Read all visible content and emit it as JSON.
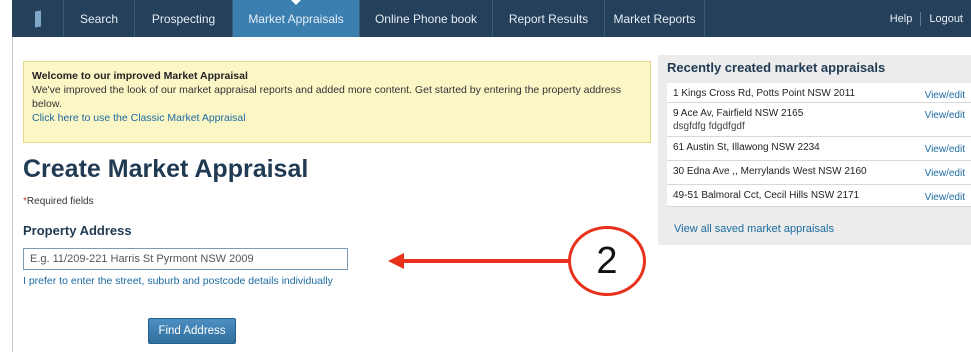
{
  "nav": {
    "items": [
      {
        "label": "Search"
      },
      {
        "label": "Prospecting"
      },
      {
        "label": "Market Appraisals"
      },
      {
        "label": "Online Phone book"
      },
      {
        "label": "Report Results"
      },
      {
        "label": "Market Reports"
      }
    ],
    "active_index": 2,
    "help": "Help",
    "logout": "Logout"
  },
  "notice": {
    "title": "Welcome to our improved Market Appraisal",
    "body": "We've improved the look of our market appraisal reports and added more content. Get started by entering the property address below.",
    "link": "Click here to use the Classic Market Appraisal"
  },
  "form": {
    "title": "Create Market Appraisal",
    "required_star": "*",
    "required_text": "Required fields",
    "section_title": "Property Address",
    "address_placeholder": "E.g. 11/209-221 Harris St Pyrmont NSW 2009",
    "manual_link": "I prefer to enter the street, suburb and postcode details individually",
    "find_button": "Find Address"
  },
  "recent": {
    "title": "Recently created market appraisals",
    "items": [
      {
        "address": "1 Kings Cross Rd, Potts Point NSW 2011",
        "sub": "",
        "action": "View/edit"
      },
      {
        "address": "9 Ace Av, Fairfield NSW 2165",
        "sub": "dsgfdfg fdgdfgdf",
        "action": "View/edit"
      },
      {
        "address": "61 Austin St, Illawong NSW 2234",
        "sub": "",
        "action": "View/edit"
      },
      {
        "address": "30 Edna Ave ,, Merrylands West NSW 2160",
        "sub": "",
        "action": "View/edit"
      },
      {
        "address": "49-51 Balmoral Cct, Cecil Hills NSW 2171",
        "sub": "",
        "action": "View/edit"
      }
    ],
    "view_all": "View all saved market appraisals"
  },
  "callout": {
    "number": "2",
    "color": "#e8321b"
  },
  "colors": {
    "nav_bg": "#24405a",
    "nav_active": "#3b7fb0",
    "link": "#1c6ba0",
    "notice_bg": "#fbf6c6"
  }
}
